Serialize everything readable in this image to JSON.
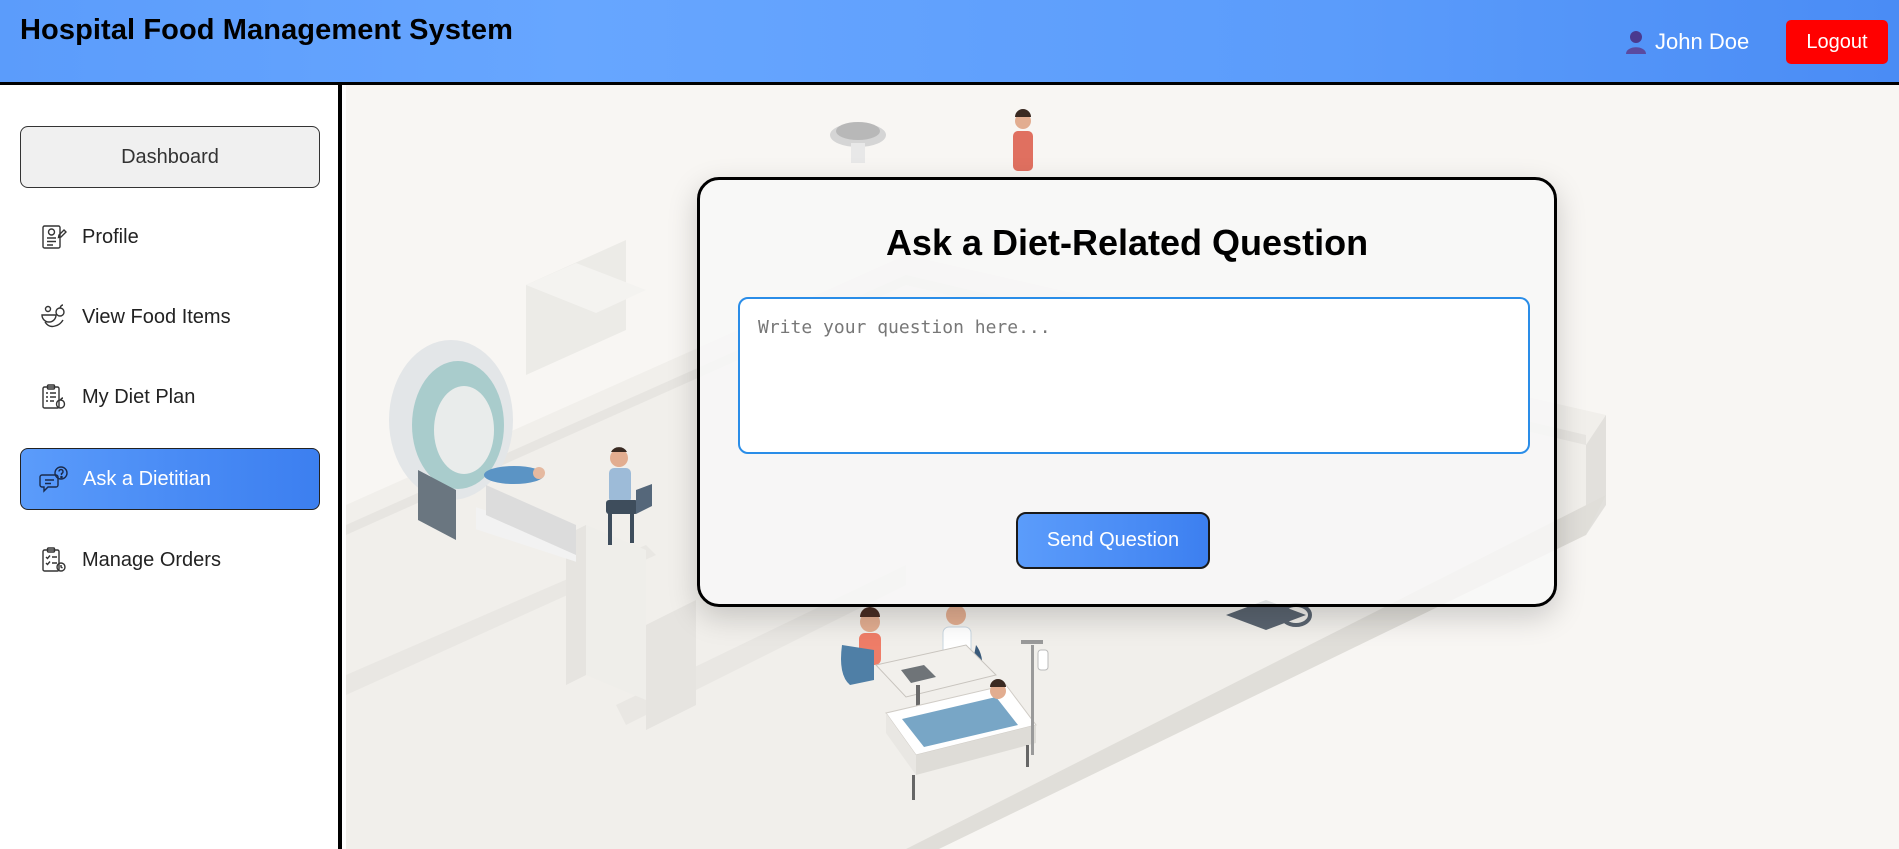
{
  "header": {
    "title": "Hospital Food Management System",
    "user_name": "John Doe",
    "logout_label": "Logout",
    "background_color": "#5b9cfb",
    "logout_color": "#ff0000"
  },
  "sidebar": {
    "items": [
      {
        "label": "Dashboard",
        "icon": "dashboard",
        "active": false
      },
      {
        "label": "Profile",
        "icon": "profile-icon",
        "active": false
      },
      {
        "label": "View Food Items",
        "icon": "food-items-icon",
        "active": false
      },
      {
        "label": "My Diet Plan",
        "icon": "diet-plan-icon",
        "active": false
      },
      {
        "label": "Ask a Dietitian",
        "icon": "ask-dietitian-icon",
        "active": true
      },
      {
        "label": "Manage Orders",
        "icon": "manage-orders-icon",
        "active": false
      }
    ],
    "active_color": "#4a8cf5"
  },
  "main": {
    "card": {
      "title": "Ask a Diet-Related Question",
      "question_placeholder": "Write your question here...",
      "question_value": "",
      "send_label": "Send Question"
    }
  }
}
